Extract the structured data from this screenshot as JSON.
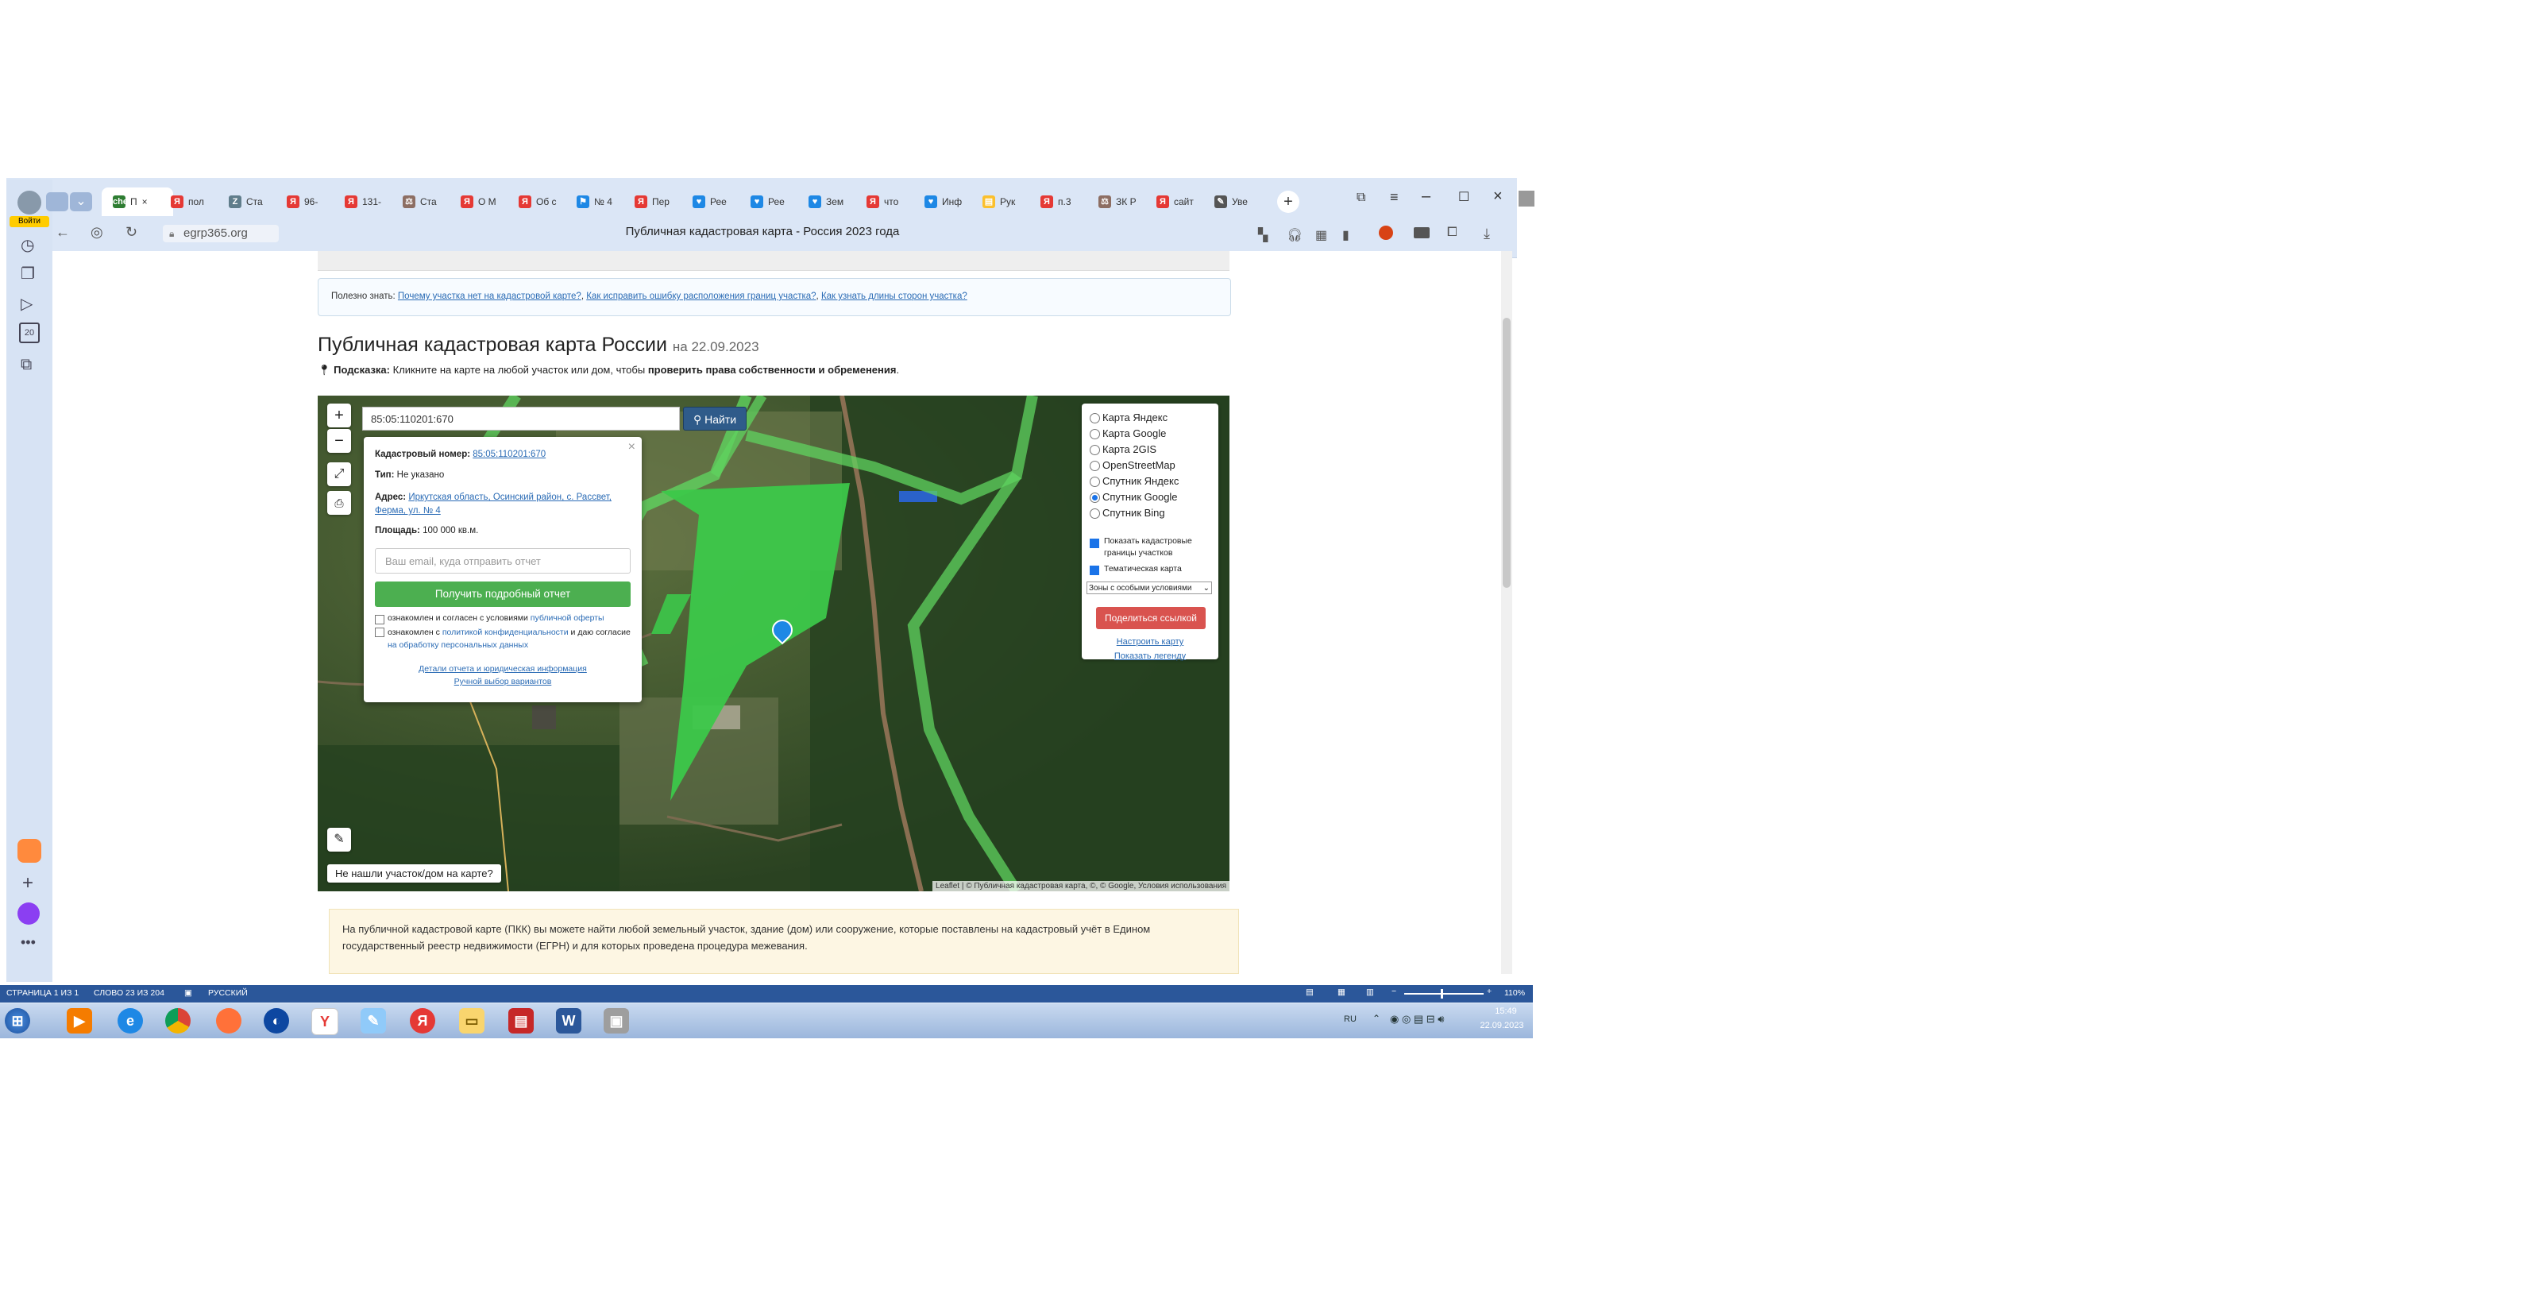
{
  "browser": {
    "address_host": "egrp365.org",
    "page_title": "Публичная кадастровая карта - Россия 2023 года",
    "account_label": "Войти",
    "side_panel_badge": "20",
    "tabs": [
      {
        "label": "П",
        "color": "#2e7d32",
        "icon": "check"
      },
      {
        "label": "пол",
        "color": "#e53935",
        "icon": "Я"
      },
      {
        "label": "Ста",
        "color": "#607d8b",
        "icon": "Z"
      },
      {
        "label": "96-",
        "color": "#e53935",
        "icon": "Я"
      },
      {
        "label": "131-",
        "color": "#e53935",
        "icon": "Я"
      },
      {
        "label": "Ста",
        "color": "#8d6e63",
        "icon": "⚖"
      },
      {
        "label": "О М",
        "color": "#e53935",
        "icon": "Я"
      },
      {
        "label": "Об с",
        "color": "#e53935",
        "icon": "Я"
      },
      {
        "label": "№ 4",
        "color": "#1e88e5",
        "icon": "⚑"
      },
      {
        "label": "Пер",
        "color": "#e53935",
        "icon": "Я"
      },
      {
        "label": "Рее",
        "color": "#1e88e5",
        "icon": "♥"
      },
      {
        "label": "Рее",
        "color": "#1e88e5",
        "icon": "♥"
      },
      {
        "label": "Зем",
        "color": "#1e88e5",
        "icon": "♥"
      },
      {
        "label": "что",
        "color": "#e53935",
        "icon": "Я"
      },
      {
        "label": "Инф",
        "color": "#1e88e5",
        "icon": "♥"
      },
      {
        "label": "Рук",
        "color": "#fbc02d",
        "icon": "▤"
      },
      {
        "label": "п.3",
        "color": "#e53935",
        "icon": "Я"
      },
      {
        "label": "ЗК Р",
        "color": "#8d6e63",
        "icon": "⚖"
      },
      {
        "label": "сайт",
        "color": "#e53935",
        "icon": "Я"
      },
      {
        "label": "Уве",
        "color": "#555555",
        "icon": "✎"
      }
    ]
  },
  "page": {
    "useful_prefix": "Полезно знать:",
    "useful_links": [
      "Почему участка нет на кадастровой карте?",
      "Как исправить ошибку расположения границ участка?",
      "Как узнать длины сторон участка?"
    ],
    "heading": "Публичная кадастровая карта России",
    "heading_date": "на 22.09.2023",
    "tip_label": "Подсказка:",
    "tip_text": "Кликните на карте на любой участок или дом, чтобы",
    "tip_bold": "проверить права собственности и обременения",
    "tip_end": ".",
    "info_text": "На публичной кадастровой карте (ПКК) вы можете найти любой земельный участок, здание (дом) или сооружение, которые поставлены на кадастровый учёт в Едином государственный реестр недвижимости (ЕГРН) и для которых проведена процедура межевания."
  },
  "map": {
    "search_value": "85:05:110201:670",
    "search_button": "Найти",
    "zoom_in": "+",
    "zoom_out": "−",
    "not_found": "Не нашли участок/дом на карте?",
    "attribution": "Leaflet | © Публичная кадастровая карта, ©, © Google, Условия использования",
    "popup": {
      "cad_label": "Кадастровый номер:",
      "cad_value": "85:05:110201:670",
      "type_label": "Тип:",
      "type_value": "Не указано",
      "address_label": "Адрес:",
      "address_value": "Иркутская область, Осинский район, с. Рассвет, Ферма, ул. № 4",
      "area_label": "Площадь:",
      "area_value": "100 000 кв.м.",
      "email_placeholder": "Ваш email, куда отправить отчет",
      "report_button": "Получить подробный отчет",
      "consent1_text": "ознакомлен и согласен с условиями",
      "consent1_link": "публичной оферты",
      "consent2_text": "ознакомлен с",
      "consent2_link": "политикой конфиденциальности",
      "consent2_mid": "и даю согласие",
      "consent2_link2": "на обработку персональных данных",
      "details_link": "Детали отчета и юридическая информация",
      "manual_link": "Ручной выбор вариантов"
    },
    "layers": [
      {
        "label": "Карта Яндекс",
        "selected": false
      },
      {
        "label": "Карта Google",
        "selected": false
      },
      {
        "label": "Карта 2GIS",
        "selected": false
      },
      {
        "label": "OpenStreetMap",
        "selected": false
      },
      {
        "label": "Спутник Яндекс",
        "selected": false
      },
      {
        "label": "Спутник Google",
        "selected": true
      },
      {
        "label": "Спутник Bing",
        "selected": false
      }
    ],
    "show_cadastral": "Показать кадастровые границы участков",
    "thematic": "Тематическая карта",
    "zones_select": "Зоны с особыми условиями",
    "share_button": "Поделиться ссылкой",
    "configure_link": "Настроить карту",
    "legend_link": "Показать легенду"
  },
  "word_status": {
    "page": "СТРАНИЦА 1 ИЗ 1",
    "words": "СЛОВО 23 ИЗ 204",
    "language": "РУССКИЙ",
    "zoom": "110%"
  },
  "taskbar": {
    "lang": "RU",
    "time": "15:49",
    "date": "22.09.2023"
  },
  "colors": {
    "parcel": "#3cc84a",
    "brand_blue": "#2b579a"
  }
}
